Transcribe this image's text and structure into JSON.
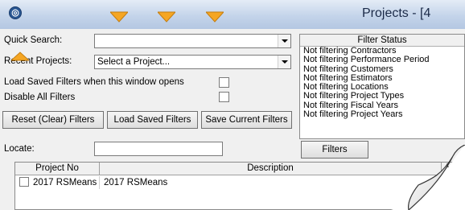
{
  "window": {
    "title": "Projects - [4"
  },
  "quick_search": {
    "label": "Quick Search:",
    "value": ""
  },
  "recent_projects": {
    "label": "Recent Projects:",
    "value": "Select a Project..."
  },
  "options": {
    "load_saved_label": "Load Saved Filters when this window opens",
    "disable_all_label": "Disable All Filters"
  },
  "buttons": {
    "reset": "Reset (Clear) Filters",
    "load_saved": "Load Saved Filters",
    "save_current": "Save Current Filters",
    "filters": "Filters"
  },
  "locate": {
    "label": "Locate:",
    "value": ""
  },
  "filter_status": {
    "header": "Filter Status",
    "items": [
      "Not filtering Contractors",
      "Not filtering Performance Period",
      "Not filtering Customers",
      "Not filtering Estimators",
      "Not filtering Locations",
      "Not filtering Project Types",
      "Not filtering Fiscal Years",
      "Not filtering Project Years"
    ]
  },
  "table": {
    "columns": [
      "Project No",
      "Description",
      "V"
    ],
    "rows": [
      {
        "project_no": "2017 RSMeans",
        "description": "2017 RSMeans"
      }
    ]
  },
  "colors": {
    "quick_access_arrow": "#f5a623",
    "titlebar": "#c4d4ea"
  }
}
